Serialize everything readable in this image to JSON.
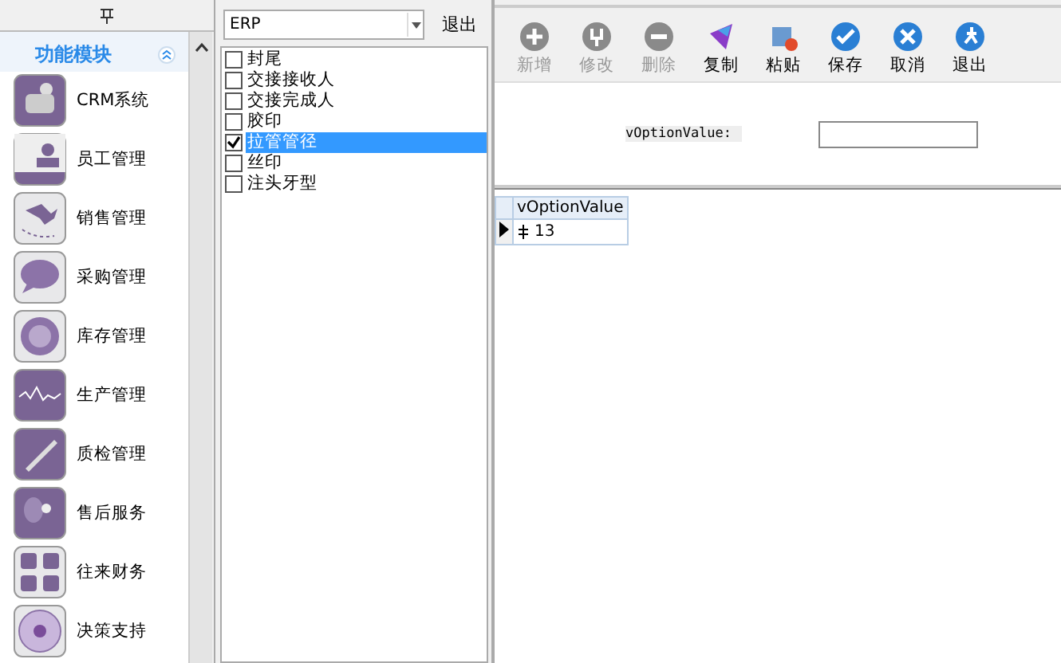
{
  "sidebar": {
    "title": "功能模块",
    "items": [
      {
        "label": "CRM系统"
      },
      {
        "label": "员工管理"
      },
      {
        "label": "销售管理"
      },
      {
        "label": "采购管理"
      },
      {
        "label": "库存管理"
      },
      {
        "label": "生产管理"
      },
      {
        "label": "质检管理"
      },
      {
        "label": "售后服务"
      },
      {
        "label": "往来财务"
      },
      {
        "label": "决策支持"
      }
    ]
  },
  "selector": {
    "value": "ERP",
    "exit_button": "退出"
  },
  "options": [
    {
      "label": "封尾",
      "checked": false,
      "selected": false
    },
    {
      "label": "交接接收人",
      "checked": false,
      "selected": false
    },
    {
      "label": "交接完成人",
      "checked": false,
      "selected": false
    },
    {
      "label": "胶印",
      "checked": false,
      "selected": false
    },
    {
      "label": "拉管管径",
      "checked": true,
      "selected": true
    },
    {
      "label": "丝印",
      "checked": false,
      "selected": false
    },
    {
      "label": "注头牙型",
      "checked": false,
      "selected": false
    }
  ],
  "toolbar": [
    {
      "label": "新增",
      "disabled": true
    },
    {
      "label": "修改",
      "disabled": true
    },
    {
      "label": "删除",
      "disabled": true
    },
    {
      "label": "复制",
      "disabled": false
    },
    {
      "label": "粘贴",
      "disabled": false
    },
    {
      "label": "保存",
      "disabled": false
    },
    {
      "label": "取消",
      "disabled": false
    },
    {
      "label": "退出",
      "disabled": false
    }
  ],
  "form": {
    "label": "vOptionValue:"
  },
  "grid": {
    "columns": [
      "vOptionValue"
    ],
    "rows": [
      {
        "cells": [
          "13"
        ],
        "selected": true
      }
    ]
  }
}
